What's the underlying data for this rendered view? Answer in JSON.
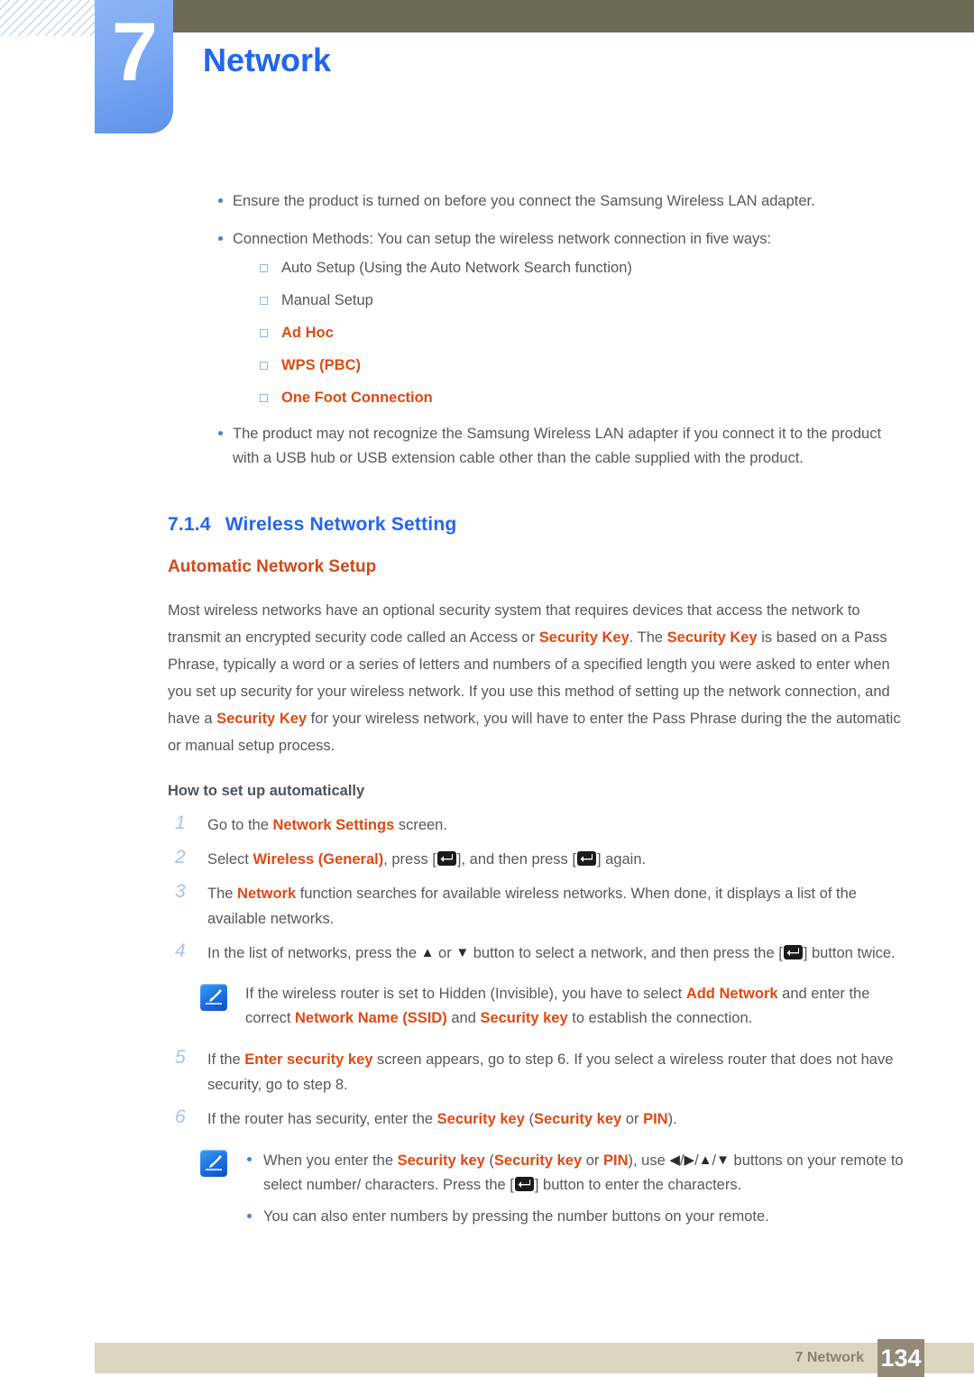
{
  "header": {
    "chapter_number": "7",
    "chapter_title": "Network"
  },
  "intro_bullets": [
    {
      "text": "Ensure the product is turned on before you connect the Samsung Wireless LAN adapter."
    },
    {
      "text": "Connection Methods: You can setup the wireless network connection in five ways:",
      "sub": [
        {
          "label": "Auto Setup (Using the Auto Network Search function)",
          "highlight": false
        },
        {
          "label": "Manual Setup",
          "highlight": false
        },
        {
          "label": "Ad Hoc",
          "highlight": true
        },
        {
          "label": "WPS (PBC)",
          "highlight": true
        },
        {
          "label": "One Foot Connection",
          "highlight": true
        }
      ]
    },
    {
      "text": "The product may not recognize the Samsung Wireless LAN adapter if you connect it to the product with a USB hub or USB extension cable other than the cable supplied with the product."
    }
  ],
  "section": {
    "number": "7.1.4",
    "title": "Wireless Network Setting",
    "subtitle": "Automatic Network Setup"
  },
  "paragraph": {
    "p1": "Most wireless networks have an optional security system that requires devices that access the network to transmit an encrypted security code called an Access or ",
    "k1": "Security Key",
    "p2": ". The ",
    "k2": "Security Key",
    "p3": " is based on a Pass Phrase, typically a word or a series of letters and numbers of a specified length you were asked to enter when you set up security for your wireless network. If you use this method of setting up the network connection, and have a ",
    "k3": "Security Key",
    "p4": " for your wireless network, you will have to enter the Pass Phrase during the the automatic or manual setup process."
  },
  "howto_heading": "How to set up automatically",
  "steps": [
    {
      "num": "1",
      "parts": [
        {
          "t": "Go to the ",
          "hl": false
        },
        {
          "t": "Network Settings",
          "hl": true
        },
        {
          "t": " screen.",
          "hl": false
        }
      ]
    },
    {
      "num": "2",
      "parts": [
        {
          "t": "Select ",
          "hl": false
        },
        {
          "t": "Wireless (General)",
          "hl": true
        },
        {
          "t": ", press [",
          "hl": false
        },
        {
          "t": "ENTER_ICON",
          "icon": "enter-key-icon"
        },
        {
          "t": "], and then press [",
          "hl": false
        },
        {
          "t": "ENTER_ICON",
          "icon": "enter-key-icon"
        },
        {
          "t": "] again.",
          "hl": false
        }
      ]
    },
    {
      "num": "3",
      "parts": [
        {
          "t": "The ",
          "hl": false
        },
        {
          "t": "Network",
          "hl": true
        },
        {
          "t": " function searches for available wireless networks. When done, it displays a list of the available networks.",
          "hl": false
        }
      ]
    },
    {
      "num": "4",
      "parts": [
        {
          "t": "In the list of networks, press the ",
          "hl": false
        },
        {
          "t": "UP_ARROW",
          "icon": "up-arrow-icon"
        },
        {
          "t": " or ",
          "hl": false
        },
        {
          "t": "DOWN_ARROW",
          "icon": "down-arrow-icon"
        },
        {
          "t": " button to select a network, and then press the [",
          "hl": false
        },
        {
          "t": "ENTER_ICON",
          "icon": "enter-key-icon"
        },
        {
          "t": "] button twice.",
          "hl": false
        }
      ]
    },
    {
      "num": "5",
      "parts": [
        {
          "t": "If the ",
          "hl": false
        },
        {
          "t": "Enter security key",
          "hl": true
        },
        {
          "t": " screen appears, go to step 6. If you select a wireless router that does not have security, go to step 8.",
          "hl": false
        }
      ]
    },
    {
      "num": "6",
      "parts": [
        {
          "t": "If the router has security, enter the ",
          "hl": false
        },
        {
          "t": "Security key",
          "hl": true
        },
        {
          "t": " (",
          "hl": false
        },
        {
          "t": "Security key",
          "hl": true
        },
        {
          "t": " or ",
          "hl": false
        },
        {
          "t": "PIN",
          "hl": true
        },
        {
          "t": ").",
          "hl": false
        }
      ]
    }
  ],
  "note1": {
    "icon": "note-pencil-icon",
    "parts": [
      {
        "t": "If the wireless router is set to Hidden (Invisible), you have to select ",
        "hl": false
      },
      {
        "t": "Add Network",
        "hl": true
      },
      {
        "t": " and enter the correct ",
        "hl": false
      },
      {
        "t": "Network Name (SSID)",
        "hl": true
      },
      {
        "t": " and ",
        "hl": false
      },
      {
        "t": "Security key",
        "hl": true
      },
      {
        "t": " to establish the connection.",
        "hl": false
      }
    ]
  },
  "note2": {
    "icon": "note-pencil-icon",
    "bullets": [
      {
        "parts": [
          {
            "t": "When you enter the ",
            "hl": false
          },
          {
            "t": "Security key",
            "hl": true
          },
          {
            "t": " (",
            "hl": false
          },
          {
            "t": "Security key",
            "hl": true
          },
          {
            "t": " or ",
            "hl": false
          },
          {
            "t": "PIN",
            "hl": true
          },
          {
            "t": "), use ",
            "hl": false
          },
          {
            "t": "LEFT_ARROW",
            "icon": "left-arrow-icon"
          },
          {
            "t": "/",
            "hl": false
          },
          {
            "t": "RIGHT_ARROW",
            "icon": "right-arrow-icon"
          },
          {
            "t": "/",
            "hl": false
          },
          {
            "t": "UP_ARROW",
            "icon": "up-arrow-icon"
          },
          {
            "t": "/",
            "hl": false
          },
          {
            "t": "DOWN_ARROW",
            "icon": "down-arrow-icon"
          },
          {
            "t": " buttons on your remote to select number/ characters. Press the [",
            "hl": false
          },
          {
            "t": "ENTER_ICON",
            "icon": "enter-key-icon"
          },
          {
            "t": "] button to enter the characters.",
            "hl": false
          }
        ]
      },
      {
        "parts": [
          {
            "t": "You can also enter numbers by pressing the number buttons on your remote.",
            "hl": false
          }
        ]
      }
    ]
  },
  "footer": {
    "label": "7 Network",
    "page_number": "134"
  },
  "colors": {
    "accent_blue": "#2266ee",
    "highlight_orange": "#e04a12",
    "subtitle_orange": "#d2491a",
    "tab_blue": "#7aa8f2",
    "olive": "#6d6a55",
    "footer_beige": "#dcd5c0",
    "footer_page_bg": "#948878",
    "body_gray": "#58585a"
  }
}
